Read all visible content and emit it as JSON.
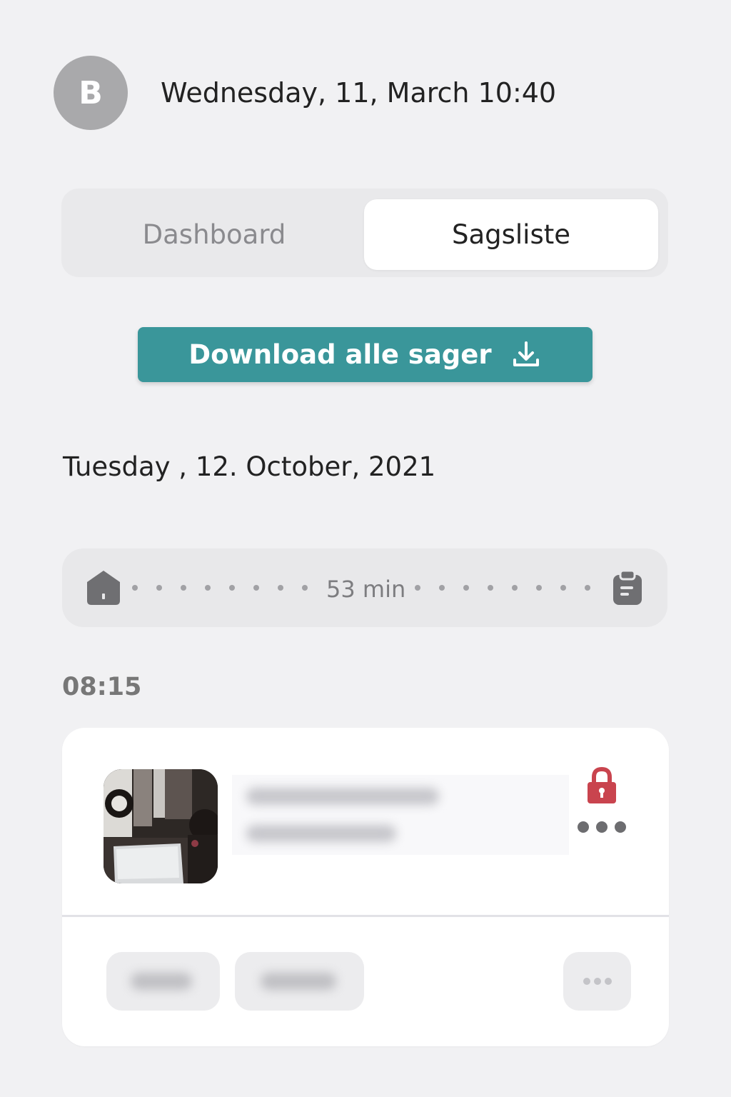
{
  "header": {
    "avatar_initial": "B",
    "datetime": "Wednesday, 11, March 10:40"
  },
  "segmented": {
    "tabs": [
      {
        "label": "Dashboard",
        "selected": false
      },
      {
        "label": "Sagsliste",
        "selected": true
      }
    ]
  },
  "download_button": {
    "label": "Download alle sager",
    "icon": "download-icon"
  },
  "day": {
    "heading": "Tuesday , 12. October, 2021"
  },
  "route": {
    "duration": "53 min",
    "start_icon": "home-icon",
    "end_icon": "clipboard-icon"
  },
  "case": {
    "time": "08:15",
    "lock_icon": "lock-icon",
    "more_icon": "more-icon"
  },
  "colors": {
    "accent": "#3a969a",
    "lock": "#c9444e",
    "background": "#f1f1f3"
  }
}
